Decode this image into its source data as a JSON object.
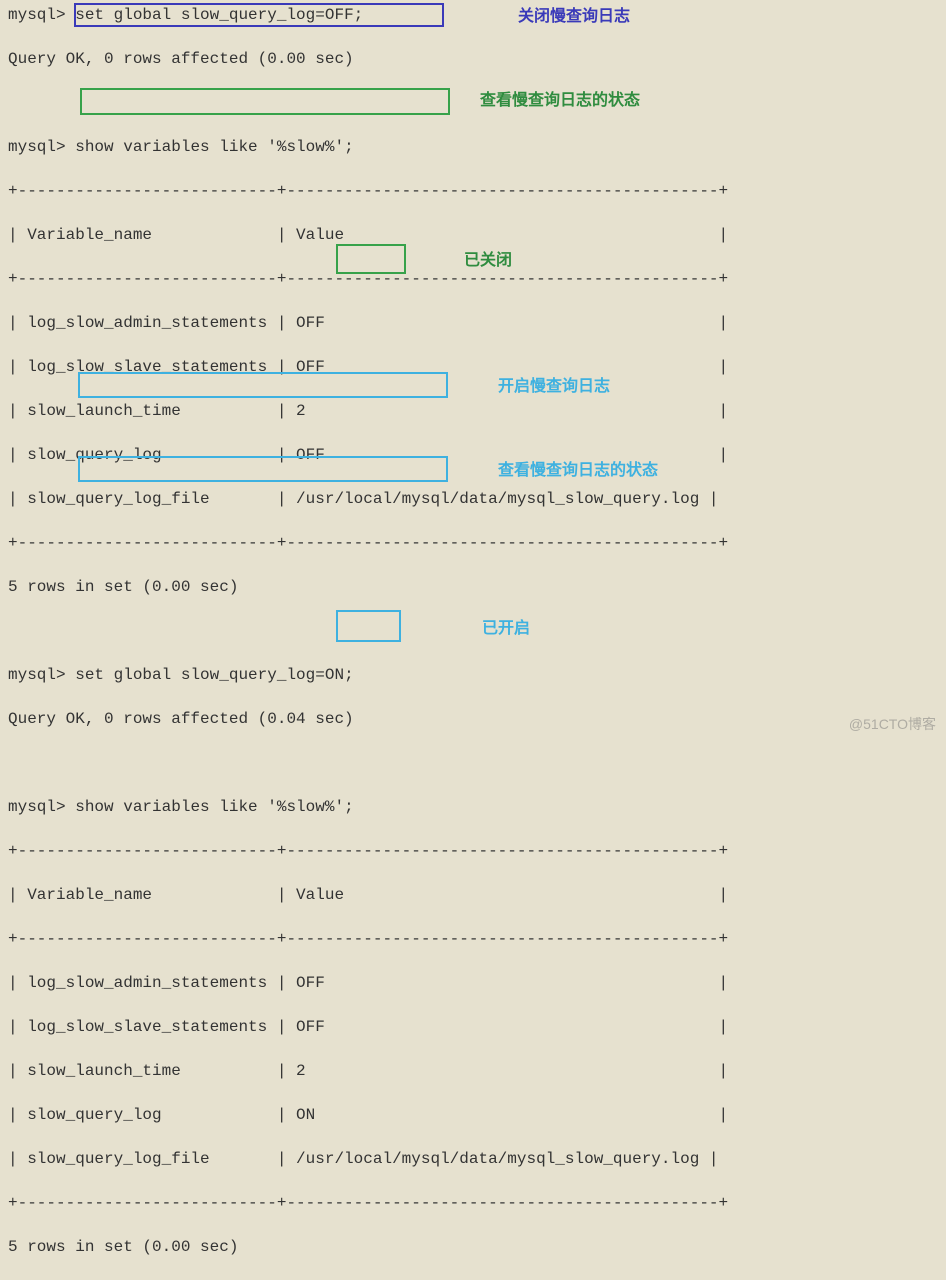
{
  "prompt": "mysql>",
  "commands": {
    "set_off": "set global slow_query_log=OFF;",
    "show1": "show variables like '%slow%';",
    "set_on": "set global slow_query_log=ON;",
    "show2": "show variables like '%slow%';"
  },
  "responses": {
    "ok0": "Query OK, 0 rows affected (0.00 sec)",
    "ok04": "Query OK, 0 rows affected (0.04 sec)",
    "rows5": "5 rows in set (0.00 sec)"
  },
  "table": {
    "border": "+---------------------------+---------------------------------------------+",
    "header": "| Variable_name             | Value                                       |",
    "rows_off": [
      "| log_slow_admin_statements | OFF                                         |",
      "| log_slow_slave_statements | OFF                                         |",
      "| slow_launch_time          | 2                                           |",
      "| slow_query_log            | OFF                                         |",
      "| slow_query_log_file       | /usr/local/mysql/data/mysql_slow_query.log |"
    ],
    "rows_on": [
      "| log_slow_admin_statements | OFF                                         |",
      "| log_slow_slave_statements | OFF                                         |",
      "| slow_launch_time          | 2                                           |",
      "| slow_query_log            | ON                                          |",
      "| slow_query_log_file       | /usr/local/mysql/data/mysql_slow_query.log |"
    ]
  },
  "annotations": {
    "close_log": "关闭慢查询日志",
    "check_log1": "查看慢查询日志的状态",
    "closed": "已关闭",
    "open_log": "开启慢查询日志",
    "check_log2": "查看慢查询日志的状态",
    "opened": "已开启"
  },
  "watermark": "@51CTO博客"
}
